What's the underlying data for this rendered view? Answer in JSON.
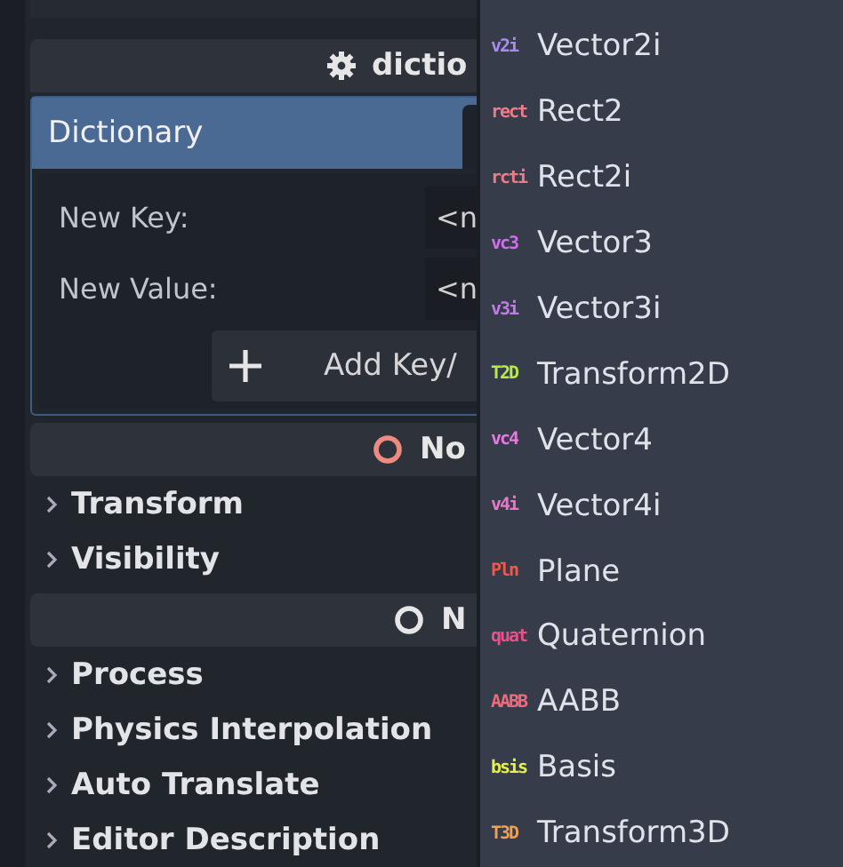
{
  "inspector": {
    "resource_header": {
      "title": "dictio"
    },
    "dictionary": {
      "title": "Dictionary",
      "new_key_label": "New Key:",
      "new_key_value": "<n",
      "new_value_label": "New Value:",
      "new_value_value": "<n",
      "add_button": "Add Key/"
    },
    "sections": [
      {
        "title": "No",
        "color": "#ee8a80",
        "groups": [
          {
            "label": "Transform",
            "expanded": false
          },
          {
            "label": "Visibility",
            "expanded": false
          }
        ]
      },
      {
        "title": "N",
        "color": "#e6e6e6",
        "groups": [
          {
            "label": "Process",
            "expanded": false
          },
          {
            "label": "Physics Interpolation",
            "expanded": false
          },
          {
            "label": "Auto Translate",
            "expanded": false
          },
          {
            "label": "Editor Description",
            "expanded": false
          }
        ]
      }
    ]
  },
  "type_menu": {
    "items": [
      {
        "badge": "v2i",
        "label": "Vector2i",
        "color": "#a78bf0"
      },
      {
        "badge": "rect",
        "label": "Rect2",
        "color": "#f07a8a"
      },
      {
        "badge": "rcti",
        "label": "Rect2i",
        "color": "#f07a8a"
      },
      {
        "badge": "vc3",
        "label": "Vector3",
        "color": "#d36cf0"
      },
      {
        "badge": "v3i",
        "label": "Vector3i",
        "color": "#c47ae8"
      },
      {
        "badge": "T2D",
        "label": "Transform2D",
        "color": "#b8e84c"
      },
      {
        "badge": "vc4",
        "label": "Vector4",
        "color": "#e878e0"
      },
      {
        "badge": "v4i",
        "label": "Vector4i",
        "color": "#e878c8"
      },
      {
        "badge": "Pln",
        "label": "Plane",
        "color": "#f0584e"
      },
      {
        "badge": "quat",
        "label": "Quaternion",
        "color": "#e8508a"
      },
      {
        "badge": "AABB",
        "label": "AABB",
        "color": "#ec6a7a"
      },
      {
        "badge": "bsis",
        "label": "Basis",
        "color": "#e4f04a"
      },
      {
        "badge": "T3D",
        "label": "Transform3D",
        "color": "#f0a050"
      }
    ]
  }
}
